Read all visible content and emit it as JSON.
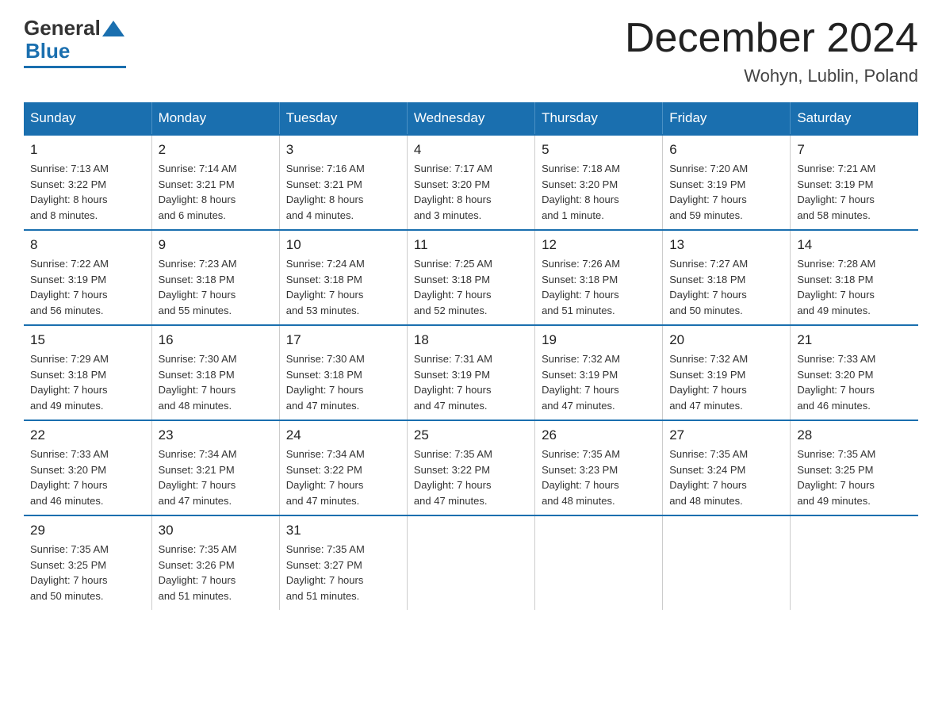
{
  "logo": {
    "general": "General",
    "blue": "Blue"
  },
  "title": "December 2024",
  "subtitle": "Wohyn, Lublin, Poland",
  "days_of_week": [
    "Sunday",
    "Monday",
    "Tuesday",
    "Wednesday",
    "Thursday",
    "Friday",
    "Saturday"
  ],
  "weeks": [
    [
      {
        "day": "1",
        "info": "Sunrise: 7:13 AM\nSunset: 3:22 PM\nDaylight: 8 hours\nand 8 minutes."
      },
      {
        "day": "2",
        "info": "Sunrise: 7:14 AM\nSunset: 3:21 PM\nDaylight: 8 hours\nand 6 minutes."
      },
      {
        "day": "3",
        "info": "Sunrise: 7:16 AM\nSunset: 3:21 PM\nDaylight: 8 hours\nand 4 minutes."
      },
      {
        "day": "4",
        "info": "Sunrise: 7:17 AM\nSunset: 3:20 PM\nDaylight: 8 hours\nand 3 minutes."
      },
      {
        "day": "5",
        "info": "Sunrise: 7:18 AM\nSunset: 3:20 PM\nDaylight: 8 hours\nand 1 minute."
      },
      {
        "day": "6",
        "info": "Sunrise: 7:20 AM\nSunset: 3:19 PM\nDaylight: 7 hours\nand 59 minutes."
      },
      {
        "day": "7",
        "info": "Sunrise: 7:21 AM\nSunset: 3:19 PM\nDaylight: 7 hours\nand 58 minutes."
      }
    ],
    [
      {
        "day": "8",
        "info": "Sunrise: 7:22 AM\nSunset: 3:19 PM\nDaylight: 7 hours\nand 56 minutes."
      },
      {
        "day": "9",
        "info": "Sunrise: 7:23 AM\nSunset: 3:18 PM\nDaylight: 7 hours\nand 55 minutes."
      },
      {
        "day": "10",
        "info": "Sunrise: 7:24 AM\nSunset: 3:18 PM\nDaylight: 7 hours\nand 53 minutes."
      },
      {
        "day": "11",
        "info": "Sunrise: 7:25 AM\nSunset: 3:18 PM\nDaylight: 7 hours\nand 52 minutes."
      },
      {
        "day": "12",
        "info": "Sunrise: 7:26 AM\nSunset: 3:18 PM\nDaylight: 7 hours\nand 51 minutes."
      },
      {
        "day": "13",
        "info": "Sunrise: 7:27 AM\nSunset: 3:18 PM\nDaylight: 7 hours\nand 50 minutes."
      },
      {
        "day": "14",
        "info": "Sunrise: 7:28 AM\nSunset: 3:18 PM\nDaylight: 7 hours\nand 49 minutes."
      }
    ],
    [
      {
        "day": "15",
        "info": "Sunrise: 7:29 AM\nSunset: 3:18 PM\nDaylight: 7 hours\nand 49 minutes."
      },
      {
        "day": "16",
        "info": "Sunrise: 7:30 AM\nSunset: 3:18 PM\nDaylight: 7 hours\nand 48 minutes."
      },
      {
        "day": "17",
        "info": "Sunrise: 7:30 AM\nSunset: 3:18 PM\nDaylight: 7 hours\nand 47 minutes."
      },
      {
        "day": "18",
        "info": "Sunrise: 7:31 AM\nSunset: 3:19 PM\nDaylight: 7 hours\nand 47 minutes."
      },
      {
        "day": "19",
        "info": "Sunrise: 7:32 AM\nSunset: 3:19 PM\nDaylight: 7 hours\nand 47 minutes."
      },
      {
        "day": "20",
        "info": "Sunrise: 7:32 AM\nSunset: 3:19 PM\nDaylight: 7 hours\nand 47 minutes."
      },
      {
        "day": "21",
        "info": "Sunrise: 7:33 AM\nSunset: 3:20 PM\nDaylight: 7 hours\nand 46 minutes."
      }
    ],
    [
      {
        "day": "22",
        "info": "Sunrise: 7:33 AM\nSunset: 3:20 PM\nDaylight: 7 hours\nand 46 minutes."
      },
      {
        "day": "23",
        "info": "Sunrise: 7:34 AM\nSunset: 3:21 PM\nDaylight: 7 hours\nand 47 minutes."
      },
      {
        "day": "24",
        "info": "Sunrise: 7:34 AM\nSunset: 3:22 PM\nDaylight: 7 hours\nand 47 minutes."
      },
      {
        "day": "25",
        "info": "Sunrise: 7:35 AM\nSunset: 3:22 PM\nDaylight: 7 hours\nand 47 minutes."
      },
      {
        "day": "26",
        "info": "Sunrise: 7:35 AM\nSunset: 3:23 PM\nDaylight: 7 hours\nand 48 minutes."
      },
      {
        "day": "27",
        "info": "Sunrise: 7:35 AM\nSunset: 3:24 PM\nDaylight: 7 hours\nand 48 minutes."
      },
      {
        "day": "28",
        "info": "Sunrise: 7:35 AM\nSunset: 3:25 PM\nDaylight: 7 hours\nand 49 minutes."
      }
    ],
    [
      {
        "day": "29",
        "info": "Sunrise: 7:35 AM\nSunset: 3:25 PM\nDaylight: 7 hours\nand 50 minutes."
      },
      {
        "day": "30",
        "info": "Sunrise: 7:35 AM\nSunset: 3:26 PM\nDaylight: 7 hours\nand 51 minutes."
      },
      {
        "day": "31",
        "info": "Sunrise: 7:35 AM\nSunset: 3:27 PM\nDaylight: 7 hours\nand 51 minutes."
      },
      {
        "day": "",
        "info": ""
      },
      {
        "day": "",
        "info": ""
      },
      {
        "day": "",
        "info": ""
      },
      {
        "day": "",
        "info": ""
      }
    ]
  ]
}
